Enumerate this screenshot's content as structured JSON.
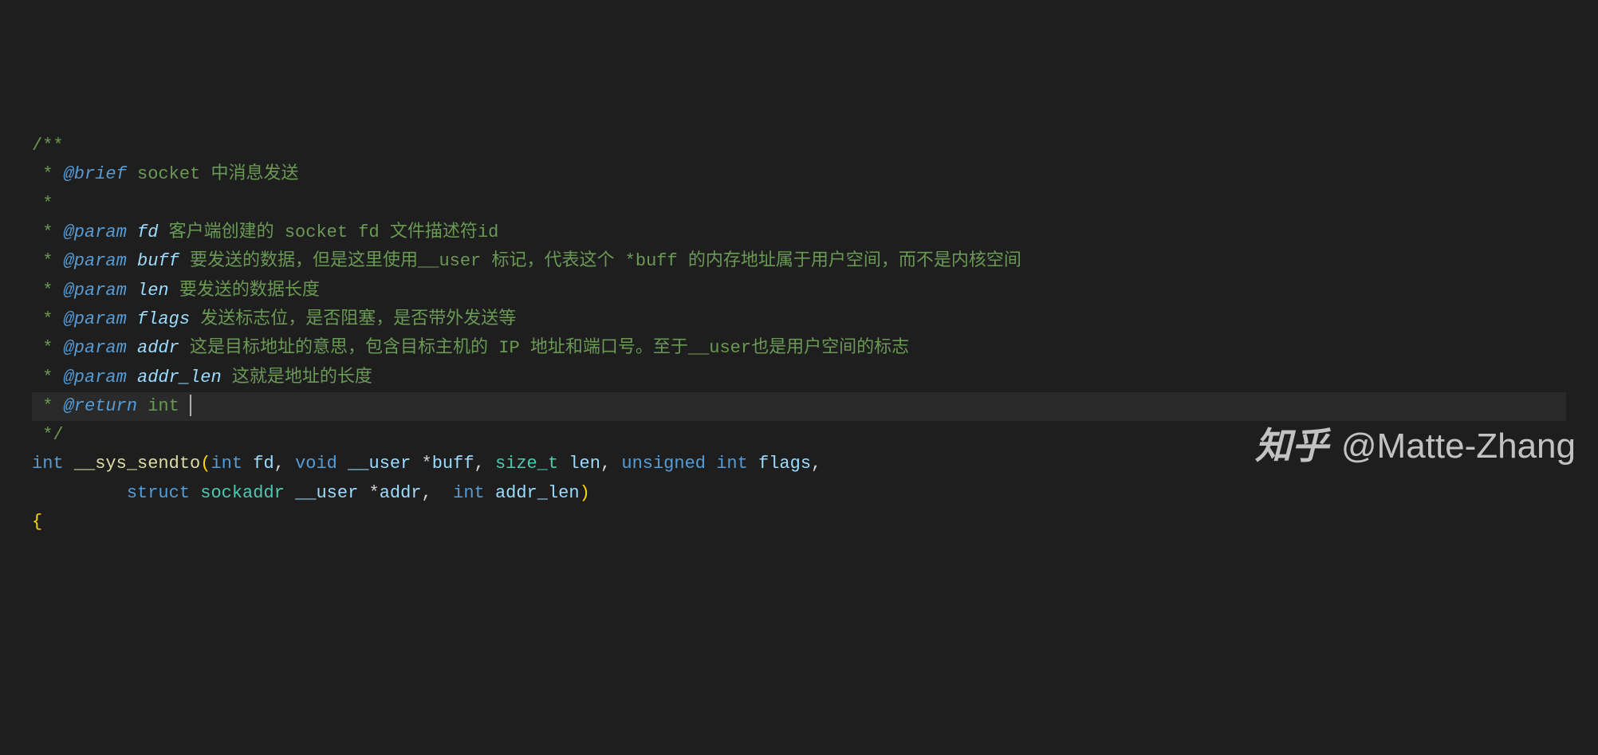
{
  "comment": {
    "open": "/**",
    "line1_star": " * ",
    "brief_tag": "@brief",
    "brief_text": " socket 中消息发送",
    "empty_star": " *",
    "param_tag": "@param",
    "param_fd_name": "fd",
    "param_fd_desc": " 客户端创建的 socket fd 文件描述符id",
    "param_buff_name": "buff",
    "param_buff_desc": " 要发送的数据，但是这里使用__user 标记，代表这个 *buff 的内存地址属于用户空间，而不是内核空间",
    "param_len_name": "len",
    "param_len_desc": " 要发送的数据长度",
    "param_flags_name": "flags",
    "param_flags_desc": " 发送标志位，是否阻塞，是否带外发送等",
    "param_addr_name": "addr",
    "param_addr_desc": " 这是目标地址的意思，包含目标主机的 IP 地址和端口号。至于__user也是用户空间的标志",
    "param_addrlen_name": "addr_len",
    "param_addrlen_desc": " 这就是地址的长度",
    "return_tag": "@return",
    "return_type": "int",
    "close": " */"
  },
  "code": {
    "int": "int",
    "func_name": "__sys_sendto",
    "lparen": "(",
    "void": "void",
    "user_attr": "__user",
    "star": "*",
    "buff": "buff",
    "size_t": "size_t",
    "len": "len",
    "unsigned": "unsigned",
    "flags": "flags",
    "fd": "fd",
    "struct": "struct",
    "sockaddr": "sockaddr",
    "addr": "addr",
    "addr_len": "addr_len",
    "rparen": ")",
    "comma": ",",
    "lbrace": "{"
  },
  "watermark": {
    "logo": "知乎",
    "author": "@Matte-Zhang"
  }
}
